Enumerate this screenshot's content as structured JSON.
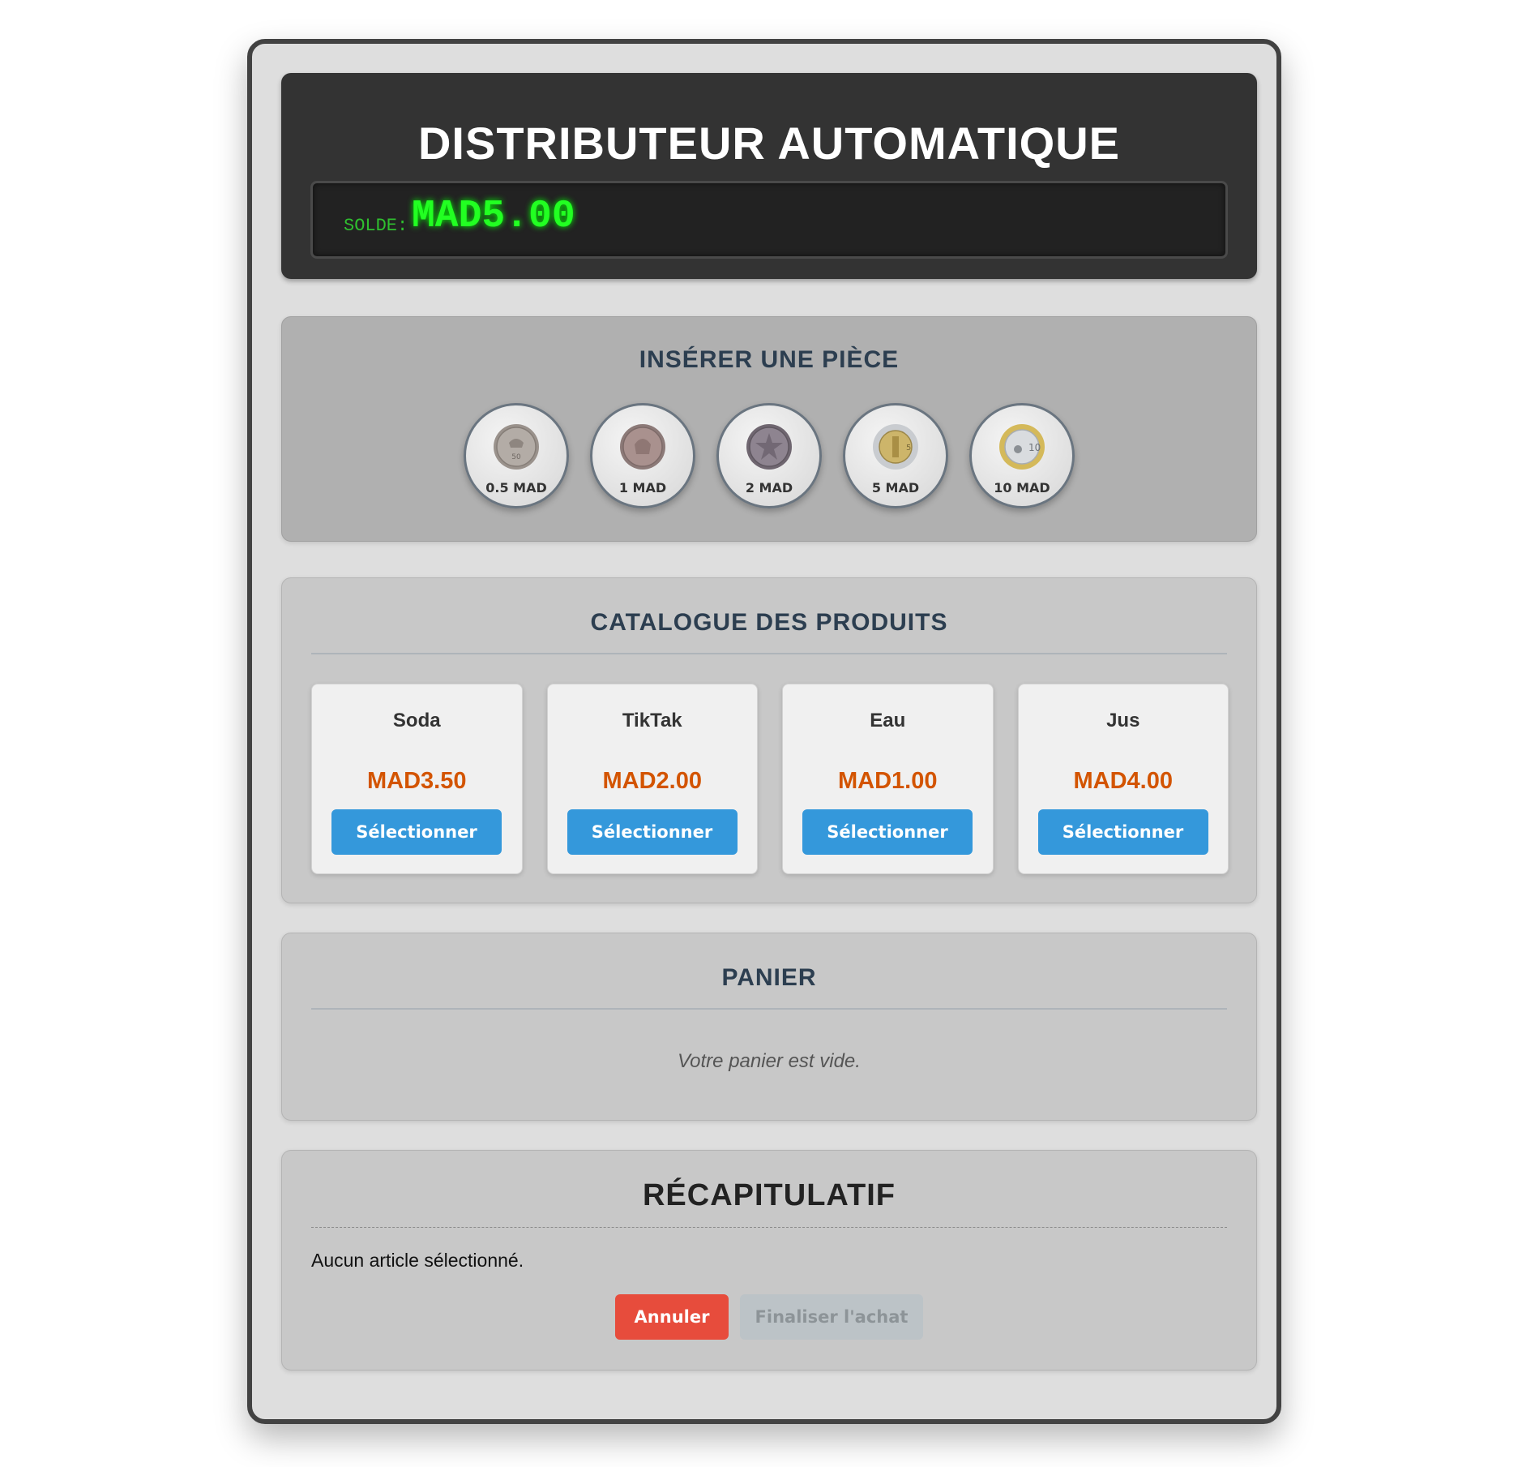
{
  "header": {
    "title": "DISTRIBUTEUR AUTOMATIQUE",
    "balance_label": "SOLDE:",
    "balance_value": "MAD5.00"
  },
  "coins": {
    "title": "INSÉRER UNE PIÈCE",
    "items": [
      {
        "label": "0.5 MAD",
        "icon": "coin-0-5-mad-icon"
      },
      {
        "label": "1 MAD",
        "icon": "coin-1-mad-icon"
      },
      {
        "label": "2 MAD",
        "icon": "coin-2-mad-icon"
      },
      {
        "label": "5 MAD",
        "icon": "coin-5-mad-icon"
      },
      {
        "label": "10 MAD",
        "icon": "coin-10-mad-icon"
      }
    ]
  },
  "catalog": {
    "title": "CATALOGUE DES PRODUITS",
    "products": [
      {
        "name": "Soda",
        "price": "MAD3.50",
        "button": "Sélectionner"
      },
      {
        "name": "TikTak",
        "price": "MAD2.00",
        "button": "Sélectionner"
      },
      {
        "name": "Eau",
        "price": "MAD1.00",
        "button": "Sélectionner"
      },
      {
        "name": "Jus",
        "price": "MAD4.00",
        "button": "Sélectionner"
      }
    ]
  },
  "cart": {
    "title": "PANIER",
    "empty_message": "Votre panier est vide."
  },
  "summary": {
    "title": "RÉCAPITULATIF",
    "message": "Aucun article sélectionné.",
    "cancel_label": "Annuler",
    "finalize_label": "Finaliser l'achat"
  },
  "colors": {
    "accent": "#3498db",
    "price": "#d35400",
    "danger": "#e74c3c",
    "display_text": "#22ff22"
  }
}
